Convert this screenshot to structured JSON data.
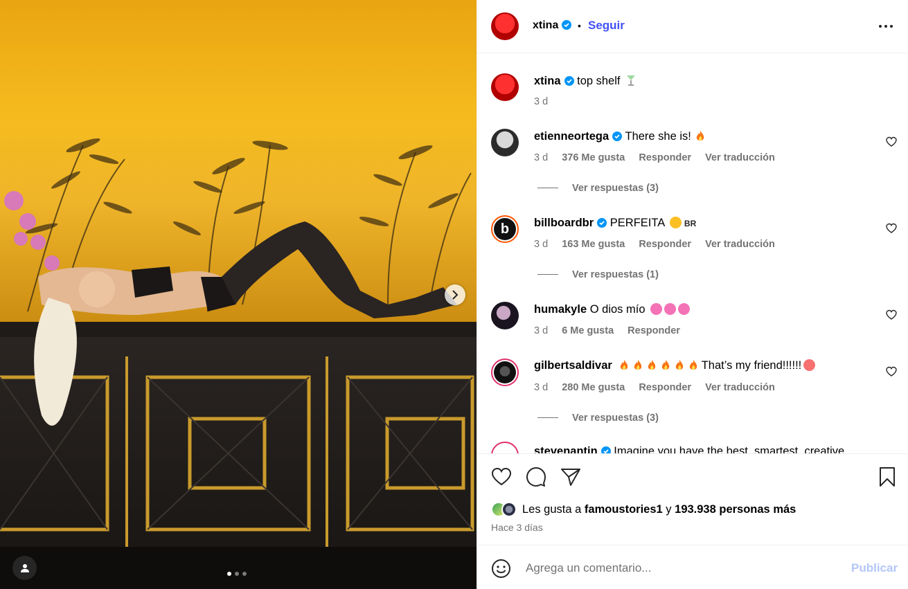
{
  "post": {
    "author": "xtina",
    "follow_label": "Seguir",
    "bullet": "•",
    "caption": "top shelf",
    "caption_time": "3 d",
    "carousel_total": 3,
    "carousel_active": 1
  },
  "comments": [
    {
      "user": "etienneortega",
      "verified": true,
      "text": "There she is!",
      "time": "3 d",
      "likes": "376 Me gusta",
      "reply": "Responder",
      "translate": "Ver traducción",
      "replies": "Ver respuestas (3)"
    },
    {
      "user": "billboardbr",
      "verified": true,
      "text": "PERFEITA",
      "flag": "BR",
      "time": "3 d",
      "likes": "163 Me gusta",
      "reply": "Responder",
      "translate": "Ver traducción",
      "replies": "Ver respuestas (1)"
    },
    {
      "user": "humakyle",
      "verified": false,
      "text": "O dios mío",
      "time": "3 d",
      "likes": "6 Me gusta",
      "reply": "Responder"
    },
    {
      "user": "gilbertsaldivar",
      "verified": false,
      "text": "That’s my friend!!!!!!",
      "time": "3 d",
      "likes": "280 Me gusta",
      "reply": "Responder",
      "translate": "Ver traducción",
      "replies": "Ver respuestas (3)"
    },
    {
      "user": "stevenantin",
      "verified": true,
      "text": "Imagine you have the best, smartest, creative"
    }
  ],
  "likes_summary": {
    "prefix": "Les gusta a",
    "user": "famoustories1",
    "conj": "y",
    "others": "193.938 personas más"
  },
  "posted_ago": "Hace 3 días",
  "composer": {
    "placeholder": "Agrega un comentario...",
    "post_label": "Publicar"
  },
  "colors": {
    "accent": "#4150f7",
    "muted": "#737373",
    "verified": "#0095f6",
    "publish_disabled": "#b3c6f7"
  },
  "icons": [
    "verified-badge-icon",
    "more-options-icon",
    "heart-icon",
    "comment-icon",
    "share-icon",
    "bookmark-icon",
    "smiley-icon",
    "chevron-right-icon",
    "user-tag-icon",
    "fire-emoji-icon"
  ]
}
